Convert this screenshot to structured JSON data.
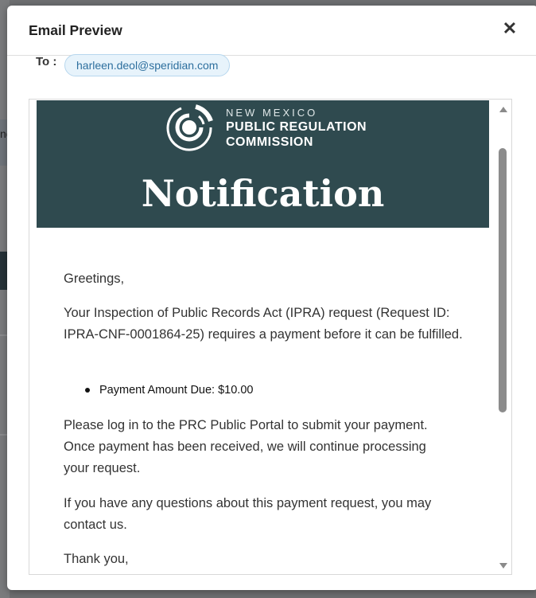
{
  "background": {
    "partial_text": "ne"
  },
  "modal": {
    "title": "Email Preview",
    "close_symbol": "✕"
  },
  "recipients": {
    "label": "To :",
    "items": [
      "harleen.deol@speridian.com"
    ]
  },
  "email": {
    "banner": {
      "logo_line1": "NEW MEXICO",
      "logo_line2": "PUBLIC REGULATION",
      "logo_line3": "COMMISSION",
      "title": "Notification",
      "color": "#2f4a4f"
    },
    "greeting": "Greetings,",
    "request_paragraph": "Your Inspection of Public Records Act (IPRA) request (Request ID: IPRA-CNF-0001864-25) requires a payment before it can be fulfilled.",
    "payment_item": "Payment Amount Due: $10.00",
    "login_paragraph": "Please log in to the PRC Public Portal to submit your payment. Once payment has been received, we will continue processing your request.",
    "questions_paragraph": "If you have any questions about this payment request, you may contact us.",
    "closing": "Thank you,"
  },
  "icons": {
    "close": "close-icon",
    "logo": "prc-logo-icon",
    "scroll_up": "scroll-up-arrow-icon",
    "scroll_down": "scroll-down-arrow-icon"
  },
  "colors": {
    "chip_background": "#e7f3fb",
    "chip_text": "#2d6f9e",
    "overlay": "#6e6f71"
  }
}
